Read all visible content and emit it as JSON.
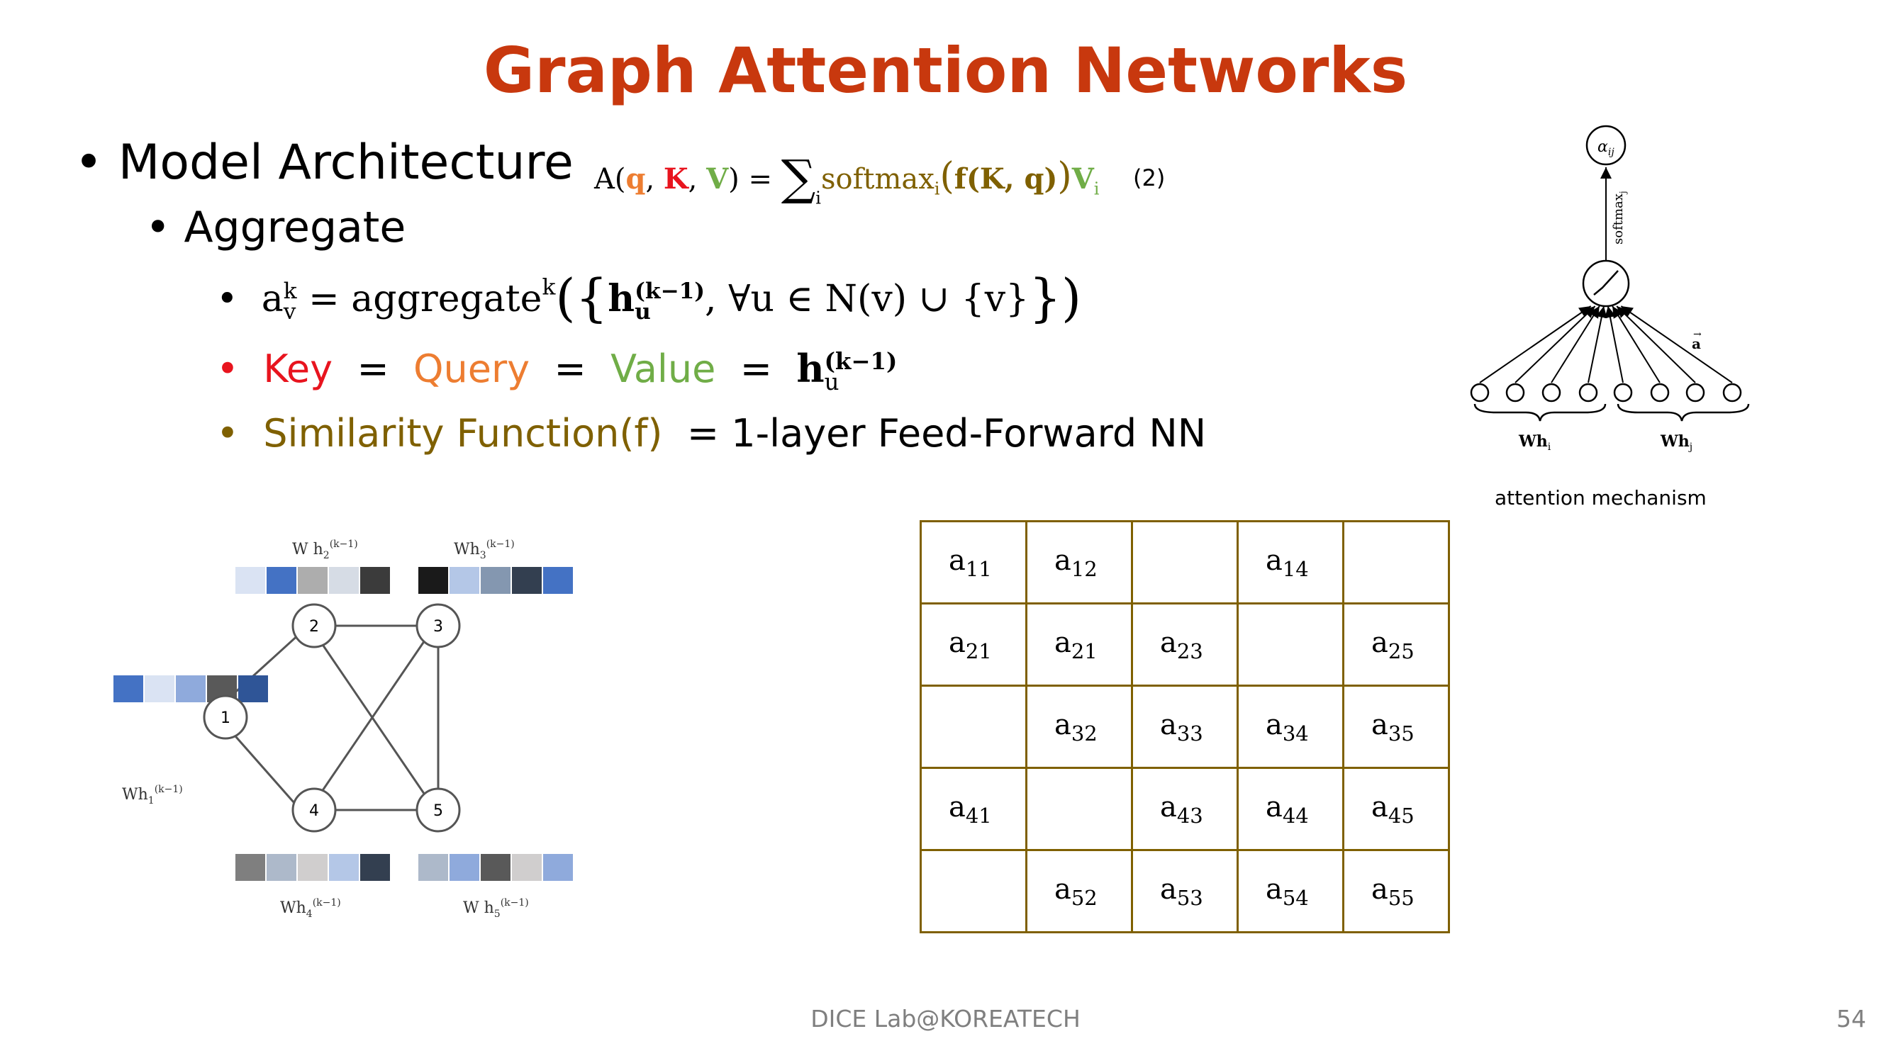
{
  "title": "Graph Attention Networks",
  "bullets": {
    "model_architecture": "Model Architecture",
    "aggregate": "Aggregate",
    "key": "Key",
    "eq1": "=",
    "query": "Query",
    "eq2": "=",
    "value": "Value",
    "eq3": "=",
    "similarity": "Similarity Function(f)",
    "ffnn": "= 1-layer Feed-Forward NN"
  },
  "formula": {
    "lhs": "A(",
    "q": "q",
    "K": "K",
    "V": "V",
    "rhs_open": ") = ",
    "softmax": "softmax",
    "f_expr": "f(K, q)",
    "Vi": "V",
    "i": "i",
    "eq_number": "(2)"
  },
  "aggregate_formula": {
    "a": "a",
    "sup_k": "k",
    "sub_v": "v",
    "equals": " = aggregate",
    "h": "h",
    "sup_k1": "(k−1)",
    "sub_u": "u",
    "rest": ", ∀u ∈ N(v) ∪ {v}"
  },
  "kqv_h": {
    "h": "h",
    "sup": "(k−1)",
    "sub": "u"
  },
  "graph": {
    "nodes": [
      "1",
      "2",
      "3",
      "4",
      "5"
    ],
    "labels": [
      "Wh",
      "W h",
      "Wh",
      "Wh",
      "W h"
    ],
    "sub": [
      "1",
      "2",
      "3",
      "4",
      "5"
    ],
    "sup": "(k−1)",
    "vectors": [
      [
        "#4472c4",
        "#dae3f3",
        "#8faadc",
        "#595959",
        "#2f5597"
      ],
      [
        "#dae3f3",
        "#4472c4",
        "#adadad",
        "#d6dce5",
        "#3b3b3b"
      ],
      [
        "#1a1a1a",
        "#b4c7e7",
        "#8497b0",
        "#333f50",
        "#4472c4"
      ],
      [
        "#7f7f7f",
        "#adb9ca",
        "#d0cece",
        "#b4c7e7",
        "#333f50"
      ],
      [
        "#adb9ca",
        "#8faadc",
        "#595959",
        "#d0cece",
        "#8faadc"
      ]
    ]
  },
  "matrix": [
    [
      "11",
      "12",
      "",
      "14",
      ""
    ],
    [
      "21",
      "21",
      "23",
      "",
      "25"
    ],
    [
      "",
      "32",
      "33",
      "34",
      "35"
    ],
    [
      "41",
      "",
      "43",
      "44",
      "45"
    ],
    [
      "",
      "52",
      "53",
      "54",
      "55"
    ]
  ],
  "attention": {
    "alpha": "α",
    "alpha_sub": "ij",
    "softmax_label": "softmax",
    "softmax_sub": "j",
    "a_vec": "a",
    "wh_i": "Wh",
    "wh_i_sub": "i",
    "wh_j": "Wh",
    "wh_j_sub": "j",
    "caption": "attention mechanism"
  },
  "footer": "DICE Lab@KOREATECH",
  "page_number": "54"
}
